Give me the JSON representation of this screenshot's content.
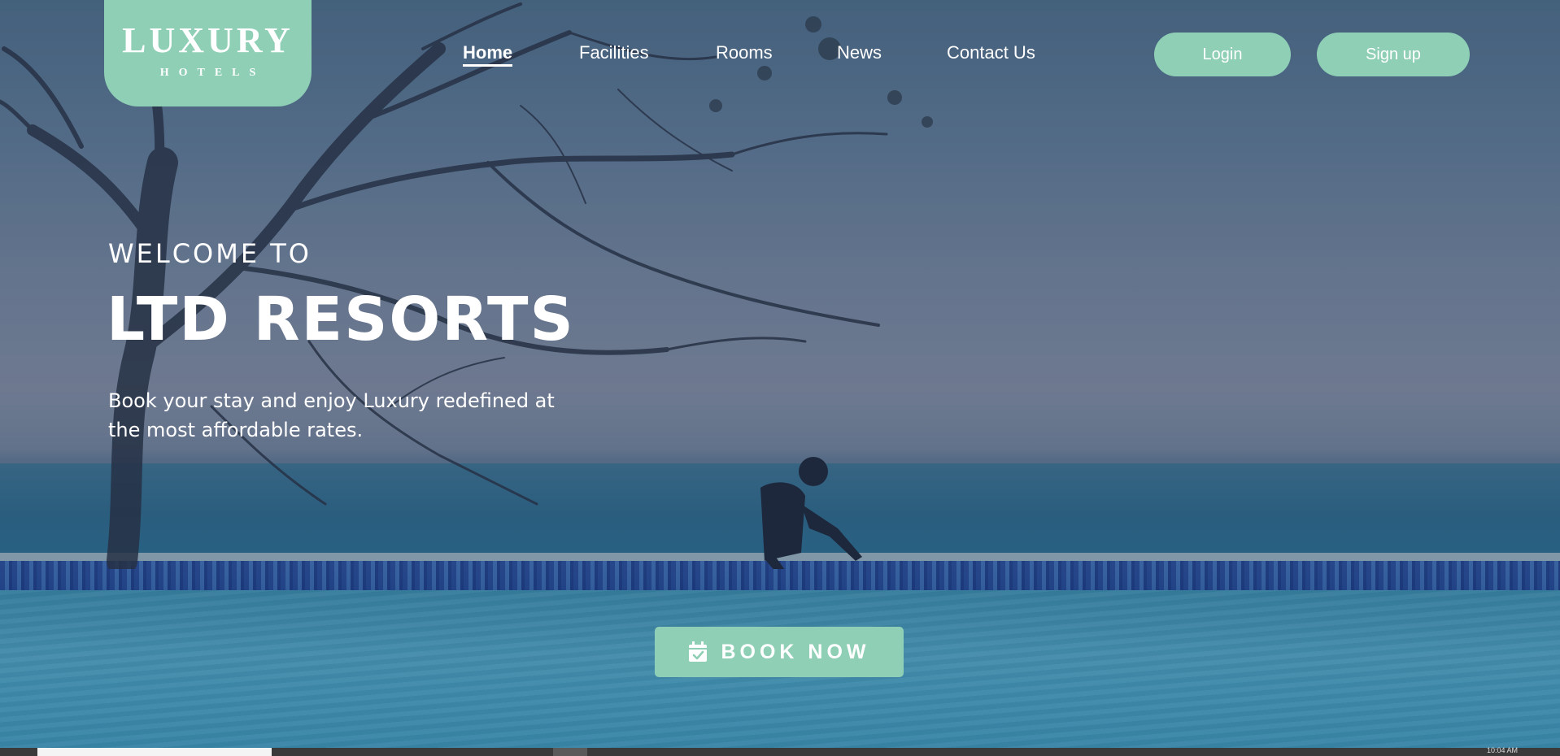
{
  "brand": {
    "logo_main": "LUXURY",
    "logo_sub": "HOTELS"
  },
  "nav": {
    "items": [
      {
        "label": "Home",
        "active": true
      },
      {
        "label": "Facilities",
        "active": false
      },
      {
        "label": "Rooms",
        "active": false
      },
      {
        "label": "News",
        "active": false
      },
      {
        "label": "Contact Us",
        "active": false
      }
    ],
    "login_label": "Login",
    "signup_label": "Sign up"
  },
  "hero": {
    "welcome": "WELCOME TO",
    "title": "LTD RESORTS",
    "subtitle": "Book your stay and enjoy Luxury redefined at the most affordable rates."
  },
  "cta": {
    "book_label": "BOOK NOW",
    "icon": "calendar-check-icon"
  },
  "taskbar": {
    "clock": "10:04 AM"
  },
  "colors": {
    "accent": "#8ecfb5",
    "text": "#ffffff"
  }
}
